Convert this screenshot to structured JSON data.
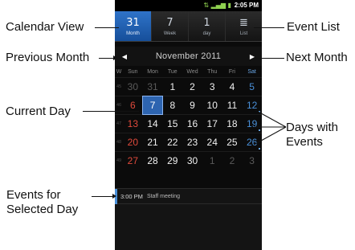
{
  "status": {
    "time": "2:05 PM",
    "icons": "⇅ ▂▄▆ ▮"
  },
  "tabs": [
    {
      "label": "Month",
      "icon": "31",
      "active": true
    },
    {
      "label": "Week",
      "icon": "7",
      "active": false
    },
    {
      "label": "day",
      "icon": "1",
      "active": false
    },
    {
      "label": "List",
      "icon": "≣",
      "active": false
    }
  ],
  "calendar": {
    "month_title": "November  2011",
    "prev_arrow": "◀",
    "next_arrow": "▶",
    "headers": [
      "W",
      "Sun",
      "Mon",
      "Tue",
      "Wed",
      "Thu",
      "Fri",
      "Sat"
    ],
    "weeks": [
      {
        "wk": "45",
        "days": [
          "30",
          "31",
          "1",
          "2",
          "3",
          "4",
          "5"
        ]
      },
      {
        "wk": "46",
        "days": [
          "6",
          "7",
          "8",
          "9",
          "10",
          "11",
          "12"
        ]
      },
      {
        "wk": "47",
        "days": [
          "13",
          "14",
          "15",
          "16",
          "17",
          "18",
          "19"
        ]
      },
      {
        "wk": "48",
        "days": [
          "20",
          "21",
          "22",
          "23",
          "24",
          "25",
          "26"
        ]
      },
      {
        "wk": "49",
        "days": [
          "27",
          "28",
          "29",
          "30",
          "1",
          "2",
          "3"
        ]
      }
    ]
  },
  "events": [
    {
      "time": "3:00 PM",
      "title": "Staff meeting"
    }
  ],
  "callouts": {
    "calendar_view": "Calendar View",
    "event_list": "Event List",
    "previous_month": "Previous Month",
    "next_month": "Next Month",
    "current_day": "Current Day",
    "days_with_events": [
      "Days with",
      "Events"
    ],
    "events_for_day": [
      "Events for",
      "Selected Day"
    ]
  }
}
